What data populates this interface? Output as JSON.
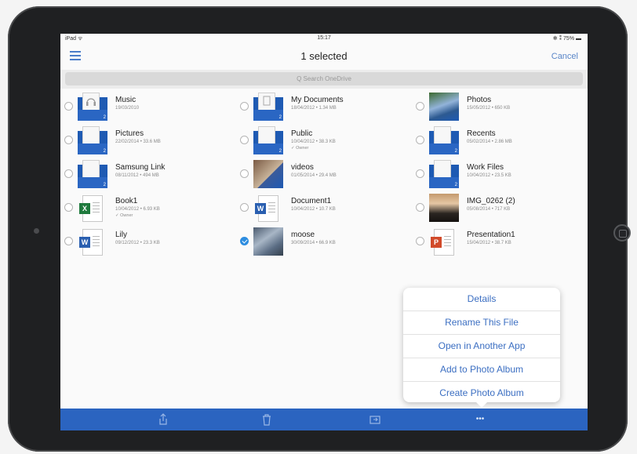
{
  "status_bar": {
    "carrier": "iPad ᯤ",
    "time": "15:17",
    "battery": "✻ ⁑ 75% ▬"
  },
  "nav": {
    "title": "1 selected",
    "cancel_label": "Cancel"
  },
  "search": {
    "placeholder": "Q Search OneDrive"
  },
  "colors": {
    "accent": "#2b64c0",
    "link": "#3c6fc2",
    "folder": "#1e5ab3"
  },
  "files": {
    "col0": [
      {
        "name": "Music",
        "meta": "19/03/2010",
        "kind": "folder-music",
        "selected": false
      },
      {
        "name": "Pictures",
        "meta": "22/02/2014 • 33.6 MB",
        "kind": "folder",
        "selected": false
      },
      {
        "name": "Samsung Link",
        "meta": "08/11/2012 • 494 MB",
        "kind": "folder",
        "selected": false
      },
      {
        "name": "Book1",
        "meta": "10/04/2012 • 6.93 KB",
        "shared": "✓ Owner",
        "kind": "excel",
        "selected": false
      },
      {
        "name": "Lily",
        "meta": "09/12/2012 • 23.3 KB",
        "kind": "word",
        "selected": false
      }
    ],
    "col1": [
      {
        "name": "My Documents",
        "meta": "18/04/2012 • 1.34 MB",
        "kind": "folder-docs",
        "selected": false
      },
      {
        "name": "Public",
        "meta": "10/04/2012 • 38.3 KB",
        "shared": "✓ Owner",
        "kind": "folder",
        "selected": false
      },
      {
        "name": "videos",
        "meta": "01/05/2014 • 29.4 MB",
        "kind": "folder-video",
        "selected": false
      },
      {
        "name": "Document1",
        "meta": "10/04/2012 • 10.7 KB",
        "kind": "word",
        "selected": false
      },
      {
        "name": "moose",
        "meta": "30/09/2014 • 66.9 KB",
        "kind": "photo-moose",
        "selected": true
      }
    ],
    "col2": [
      {
        "name": "Photos",
        "meta": "15/05/2012 • 650 KB",
        "kind": "folder-photo",
        "selected": false
      },
      {
        "name": "Recents",
        "meta": "05/02/2014 • 2.86 MB",
        "kind": "folder",
        "selected": false
      },
      {
        "name": "Work Files",
        "meta": "10/04/2012 • 23.5 KB",
        "kind": "folder",
        "selected": false
      },
      {
        "name": "IMG_0262 (2)",
        "meta": "05/08/2014 • 717 KB",
        "kind": "photo-sunset",
        "selected": false
      },
      {
        "name": "Presentation1",
        "meta": "15/04/2012 • 38.7 KB",
        "kind": "powerpoint",
        "selected": false
      }
    ]
  },
  "popover": {
    "items": [
      "Details",
      "Rename This File",
      "Open in Another App",
      "Add to Photo Album",
      "Create Photo Album"
    ]
  },
  "toolbar": {
    "share_icon": "share-icon",
    "trash_icon": "trash-icon",
    "move_icon": "move-icon",
    "more_label": "•••"
  }
}
